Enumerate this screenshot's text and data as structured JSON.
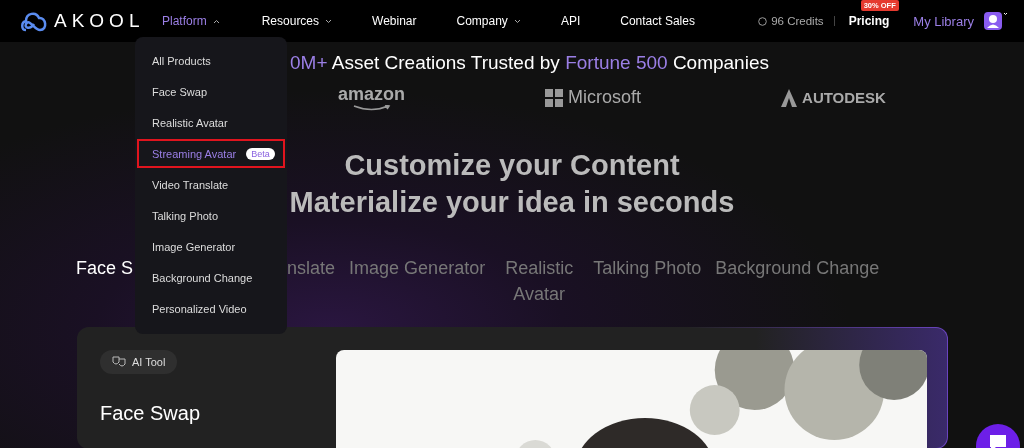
{
  "logo": {
    "text": "AKOOL"
  },
  "nav": [
    {
      "label": "Platform",
      "dropdown": true,
      "selected": true
    },
    {
      "label": "Resources",
      "dropdown": true,
      "selected": false
    },
    {
      "label": "Webinar",
      "dropdown": false,
      "selected": false
    },
    {
      "label": "Company",
      "dropdown": true,
      "selected": false
    },
    {
      "label": "API",
      "dropdown": false,
      "selected": false
    },
    {
      "label": "Contact Sales",
      "dropdown": false,
      "selected": false
    }
  ],
  "credits": "96 Credits",
  "pricing": {
    "label": "Pricing",
    "badge": "30% OFF"
  },
  "library": "My Library",
  "platform_menu": [
    {
      "label": "All Products",
      "highlighted": false
    },
    {
      "label": "Face Swap",
      "highlighted": false
    },
    {
      "label": "Realistic Avatar",
      "highlighted": false
    },
    {
      "label": "Streaming Avatar",
      "badge": "Beta",
      "highlighted": true
    },
    {
      "label": "Video Translate",
      "highlighted": false
    },
    {
      "label": "Talking Photo",
      "highlighted": false
    },
    {
      "label": "Image Generator",
      "highlighted": false
    },
    {
      "label": "Background Change",
      "highlighted": false
    },
    {
      "label": "Personalized Video",
      "highlighted": false
    }
  ],
  "trust_line": {
    "accent_start": "0M+",
    "middle": "Asset Creations Trusted by",
    "accent": "Fortune 500",
    "end": "Companies"
  },
  "partners": [
    {
      "name": "amazon",
      "kind": "amazon"
    },
    {
      "name": "Microsoft",
      "kind": "microsoft"
    },
    {
      "name": "AUTODESK",
      "kind": "autodesk"
    }
  ],
  "headline": [
    "Customize your Content",
    "Materialize your idea in seconds"
  ],
  "product_tabs": [
    {
      "label": "Face S",
      "selected": true
    },
    {
      "label": "nslate",
      "selected": false
    },
    {
      "label": "Image Generator",
      "selected": false
    },
    {
      "label": "Realistic Avatar",
      "selected": false
    },
    {
      "label": "Talking Photo",
      "selected": false
    },
    {
      "label": "Background Change",
      "selected": false
    }
  ],
  "feature_card": {
    "tag": "AI Tool",
    "title": "Face Swap"
  }
}
